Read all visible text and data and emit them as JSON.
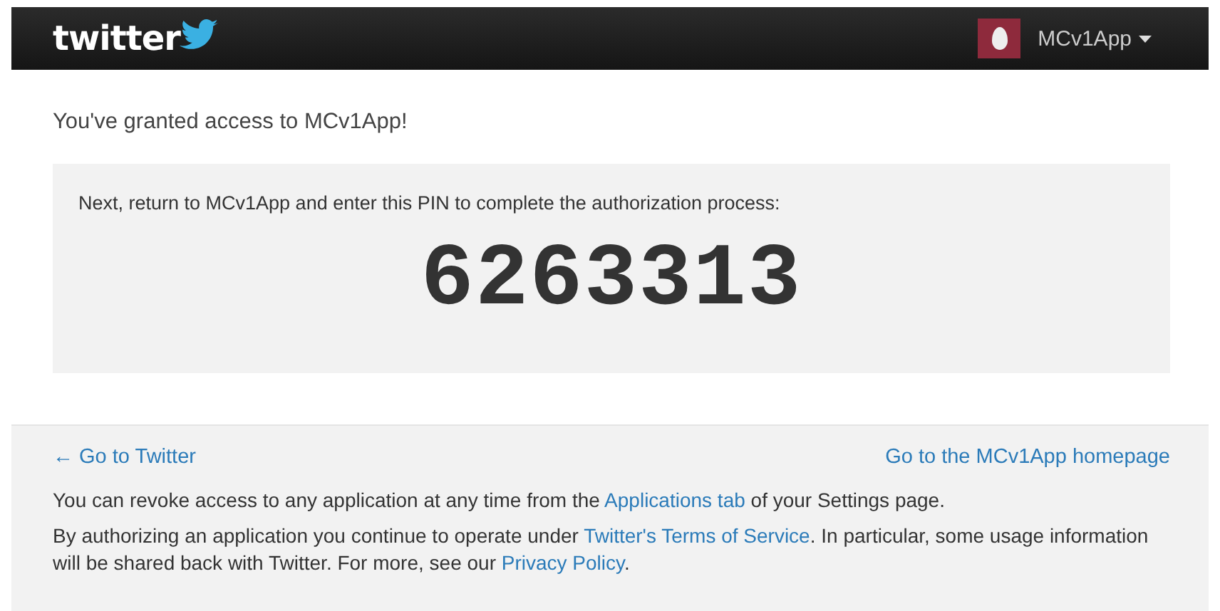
{
  "header": {
    "logo": "twitter",
    "account": {
      "name": "MCv1App"
    }
  },
  "heading": "You've granted access to MCv1App!",
  "pin_box": {
    "instruction": "Next, return to MCv1App and enter this PIN to complete the authorization process:",
    "pin": "6263313"
  },
  "footer": {
    "back_link": "← Go to Twitter",
    "homepage_link": "Go to the MCv1App homepage",
    "paragraphs": [
      [
        {
          "text": "You can revoke access to any application at any time from the "
        },
        {
          "text": "Applications tab",
          "link": true
        },
        {
          "text": " of your Settings page."
        }
      ],
      [
        {
          "text": "By authorizing an application you continue to operate under "
        },
        {
          "text": "Twitter's Terms of Service",
          "link": true
        },
        {
          "text": ". In particular, some usage information will be shared back with Twitter. For more, see our "
        },
        {
          "text": "Privacy Policy",
          "link": true
        },
        {
          "text": "."
        }
      ]
    ]
  }
}
